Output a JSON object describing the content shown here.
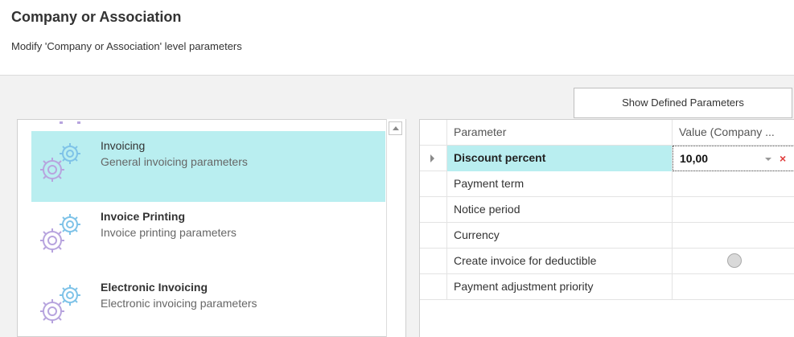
{
  "header": {
    "title": "Company or Association",
    "subtitle": "Modify 'Company or Association' level parameters"
  },
  "toolbar": {
    "show_defined_label": "Show Defined Parameters"
  },
  "categories": [
    {
      "title": "Invoicing",
      "description": "General invoicing parameters",
      "selected": true,
      "icon": "gears-icon"
    },
    {
      "title": "Invoice Printing",
      "description": "Invoice printing parameters",
      "selected": false,
      "icon": "gears-icon"
    },
    {
      "title": "Electronic Invoicing",
      "description": "Electronic invoicing parameters",
      "selected": false,
      "icon": "gears-icon"
    }
  ],
  "grid": {
    "columns": [
      "Parameter",
      "Value (Company ..."
    ],
    "rows": [
      {
        "parameter": "Discount percent",
        "value": "10,00",
        "selected": true
      },
      {
        "parameter": "Payment term",
        "value": ""
      },
      {
        "parameter": "Notice period",
        "value": ""
      },
      {
        "parameter": "Currency",
        "value": ""
      },
      {
        "parameter": "Create invoice for deductible",
        "value": "",
        "toggle": true
      },
      {
        "parameter": "Payment adjustment priority",
        "value": ""
      }
    ]
  },
  "colors": {
    "selection": "#b9eef0",
    "gear_blue": "#7fc3e8",
    "gear_purple": "#b7a4de",
    "clear_red": "#e03c3c"
  }
}
